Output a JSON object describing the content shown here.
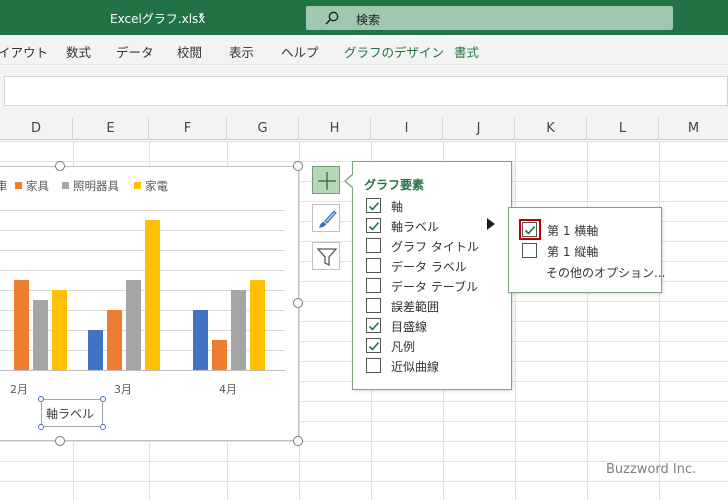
{
  "titlebar": {
    "document_title": "Excelグラフ.xlsx",
    "caret": "▾",
    "search_icon": "search-icon",
    "search_text": "検索"
  },
  "ribbon": {
    "tabs": [
      {
        "label": "イアウト",
        "accent": false
      },
      {
        "label": "数式",
        "accent": false
      },
      {
        "label": "データ",
        "accent": false
      },
      {
        "label": "校閲",
        "accent": false
      },
      {
        "label": "表示",
        "accent": false
      },
      {
        "label": "ヘルプ",
        "accent": false
      },
      {
        "label": "グラフのデザイン",
        "accent": true
      },
      {
        "label": "書式",
        "accent": true
      }
    ]
  },
  "columns": [
    "D",
    "E",
    "F",
    "G",
    "H",
    "I",
    "J",
    "K",
    "L",
    "M"
  ],
  "chart": {
    "legend": [
      {
        "label": "車",
        "color": "#4472c4"
      },
      {
        "label": "家具",
        "color": "#ed7d31"
      },
      {
        "label": "照明器具",
        "color": "#a5a5a5"
      },
      {
        "label": "家電",
        "color": "#ffc000"
      }
    ],
    "axis_label_placeholder": "軸ラベル"
  },
  "chart_data": {
    "type": "bar",
    "categories": [
      "2月",
      "3月",
      "4月"
    ],
    "series": [
      {
        "name": "車",
        "color": "#4472c4",
        "values": [
          null,
          2,
          3
        ]
      },
      {
        "name": "家具",
        "color": "#ed7d31",
        "values": [
          4.5,
          3,
          1.5
        ]
      },
      {
        "name": "照明器具",
        "color": "#a5a5a5",
        "values": [
          3.5,
          4.5,
          4
        ]
      },
      {
        "name": "家電",
        "color": "#ffc000",
        "values": [
          4,
          7.5,
          4.5
        ]
      }
    ],
    "ylim": [
      0,
      7.5
    ],
    "grid": true,
    "legend": "top"
  },
  "tools": {
    "chart_elements_icon": "plus-icon",
    "chart_styles_icon": "brush-icon",
    "chart_filters_icon": "filter-icon"
  },
  "flyout": {
    "title": "グラフ要素",
    "items": [
      {
        "label": "軸",
        "checked": true
      },
      {
        "label": "軸ラベル",
        "checked": true
      },
      {
        "label": "グラフ タイトル",
        "checked": false
      },
      {
        "label": "データ ラベル",
        "checked": false
      },
      {
        "label": "データ テーブル",
        "checked": false
      },
      {
        "label": "誤差範囲",
        "checked": false
      },
      {
        "label": "目盛線",
        "checked": true
      },
      {
        "label": "凡例",
        "checked": true
      },
      {
        "label": "近似曲線",
        "checked": false
      }
    ]
  },
  "submenu": {
    "items": [
      {
        "label": "第 1 横軸",
        "checked": true
      },
      {
        "label": "第 1 縦軸",
        "checked": false
      }
    ],
    "more_options": "その他のオプション..."
  },
  "watermark": "Buzzword Inc."
}
